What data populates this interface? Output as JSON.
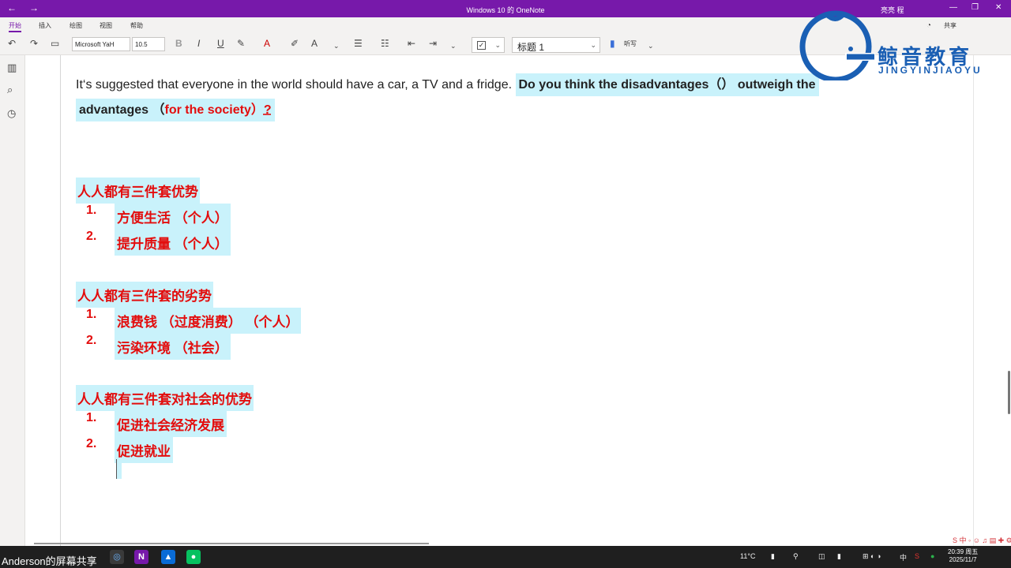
{
  "window": {
    "title": "Windows 10 的 OneNote",
    "user": "亮亮 程"
  },
  "ribbon_tabs": [
    "开始",
    "插入",
    "绘图",
    "视图",
    "帮助"
  ],
  "toolbar": {
    "font": "Microsoft YaH",
    "font_size": "10.5",
    "style": "标题 1",
    "dictate": "听写",
    "share": "共享"
  },
  "content": {
    "question_plain": "It‘s suggested that everyone in the world should have a car, a TV and a fridge. ",
    "question_bold": "Do you think the disadvantages（） outweigh the",
    "question_bold_line2": "advantages （",
    "question_red": "for the society",
    "question_close": "）",
    "question_mark": "?",
    "sections": [
      {
        "heading": "人人都有三件套优势",
        "items": [
          {
            "num": "1.",
            "text": "方便生活 （个人）"
          },
          {
            "num": "2.",
            "text": "提升质量 （个人）"
          }
        ]
      },
      {
        "heading": "人人都有三件套的劣势",
        "items": [
          {
            "num": "1.",
            "text": "浪费钱 （过度消费） （个人）"
          },
          {
            "num": "2.",
            "text": "污染环境 （社会）"
          }
        ]
      },
      {
        "heading": "人人都有三件套对社会的优势",
        "items": [
          {
            "num": "1.",
            "text": "促进社会经济发展"
          },
          {
            "num": "2.",
            "text": "促进就业"
          }
        ]
      }
    ]
  },
  "logo": {
    "brand": "鲸音教育",
    "pinyin": "JINGYINJIAOYU"
  },
  "taskbar": {
    "screen_share": "Anderson的屏幕共享",
    "weather": "11°C",
    "ime": "中",
    "time": "20:39 周五",
    "date": "2025/11/7"
  },
  "colors": {
    "onenote_purple": "#7719aa",
    "highlight": "#c9f2fb",
    "red_text": "#e30d0d",
    "logo_blue": "#1a5fb4"
  }
}
